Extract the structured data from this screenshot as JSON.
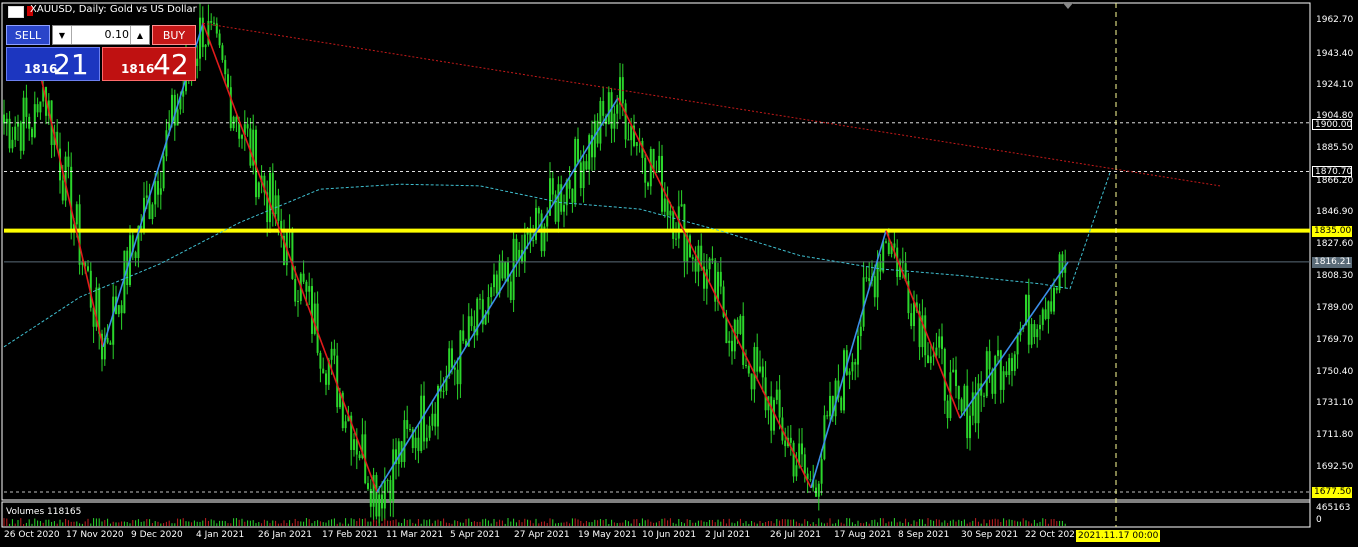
{
  "header": {
    "title": "XAUUSD, Daily:  Gold vs US Dollar",
    "chart_icon": "chart-icon"
  },
  "trade_panel": {
    "sell_label": "SELL",
    "buy_label": "BUY",
    "lot_value": "0.10",
    "sell_price_small": "1816",
    "sell_price_big": "21",
    "buy_price_small": "1816",
    "buy_price_big": "42"
  },
  "price_axis": [
    "1962.70",
    "1943.40",
    "1924.10",
    "1904.80",
    "1885.50",
    "1866.20",
    "1846.90",
    "1827.60",
    "1808.30",
    "1789.00",
    "1769.70",
    "1750.40",
    "1731.10",
    "1711.80",
    "1692.50"
  ],
  "price_tags": {
    "level_1900": "1900.00",
    "level_1870": "1870.70",
    "level_1835": "1835.00",
    "current": "1816.21",
    "low": "1677.50"
  },
  "volume": {
    "label": "Volumes 118165",
    "axis_max": "465163",
    "axis_zero": "0"
  },
  "time_axis": [
    "26 Oct 2020",
    "17 Nov 2020",
    "9 Dec 2020",
    "4 Jan 2021",
    "26 Jan 2021",
    "17 Feb 2021",
    "11 Mar 2021",
    "5 Apr 2021",
    "27 Apr 2021",
    "19 May 2021",
    "10 Jun 2021",
    "2 Jul 2021",
    "26 Jul 2021",
    "17 Aug 2021",
    "8 Sep 2021",
    "30 Sep 2021",
    "22 Oct 2021"
  ],
  "cursor_date": "2021.11.17 00:00",
  "colors": {
    "candle": "#2bd62b",
    "zigzag_up": "#3b8ee8",
    "zigzag_down": "#e11b1b",
    "support": "#ffff00",
    "trendline": "#c41a1a",
    "ma": "#3fbfd0"
  },
  "chart_data": {
    "type": "line",
    "symbol": "XAUUSD",
    "timeframe": "Daily",
    "ylim": [
      1677.5,
      1968
    ],
    "x": [
      "26 Oct 2020",
      "17 Nov 2020",
      "9 Dec 2020",
      "4 Jan 2021",
      "26 Jan 2021",
      "17 Feb 2021",
      "11 Mar 2021",
      "5 Apr 2021",
      "27 Apr 2021",
      "19 May 2021",
      "10 Jun 2021",
      "2 Jul 2021",
      "26 Jul 2021",
      "17 Aug 2021",
      "8 Sep 2021",
      "30 Sep 2021",
      "22 Oct 2021"
    ],
    "series": [
      {
        "name": "close",
        "values": [
          1905,
          1865,
          1840,
          1945,
          1850,
          1780,
          1725,
          1745,
          1780,
          1875,
          1860,
          1790,
          1800,
          1790,
          1800,
          1760,
          1790
        ]
      }
    ],
    "zigzag": [
      1930,
      1765,
      1960,
      1677.5,
      1915,
      1680,
      1835,
      1722,
      1816
    ]
  }
}
